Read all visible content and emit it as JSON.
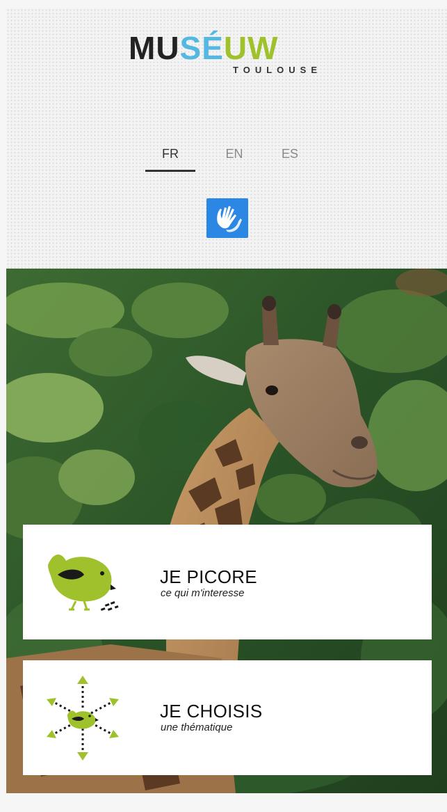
{
  "brand": {
    "logo_part1": "MU",
    "logo_part2": "SÉ",
    "logo_part3": "UW",
    "logo_sub": "TOULOUSE",
    "colors": {
      "dark": "#222222",
      "blue": "#55b8e3",
      "green": "#9ec12c"
    }
  },
  "languages": [
    {
      "label": "FR",
      "active": true
    },
    {
      "label": "EN",
      "active": false
    },
    {
      "label": "ES",
      "active": false
    }
  ],
  "accessibility": {
    "icon": "sign-language-icon",
    "color": "#2b87e3"
  },
  "hero": {
    "image": "giraffe-photo"
  },
  "cards": [
    {
      "title": "JE PICORE",
      "subtitle": "ce qui m'interesse",
      "icon": "pecking-bird-icon"
    },
    {
      "title": "JE CHOISIS",
      "subtitle": "une thématique",
      "icon": "bird-arrows-icon"
    }
  ],
  "accent_green": "#9ec12c"
}
